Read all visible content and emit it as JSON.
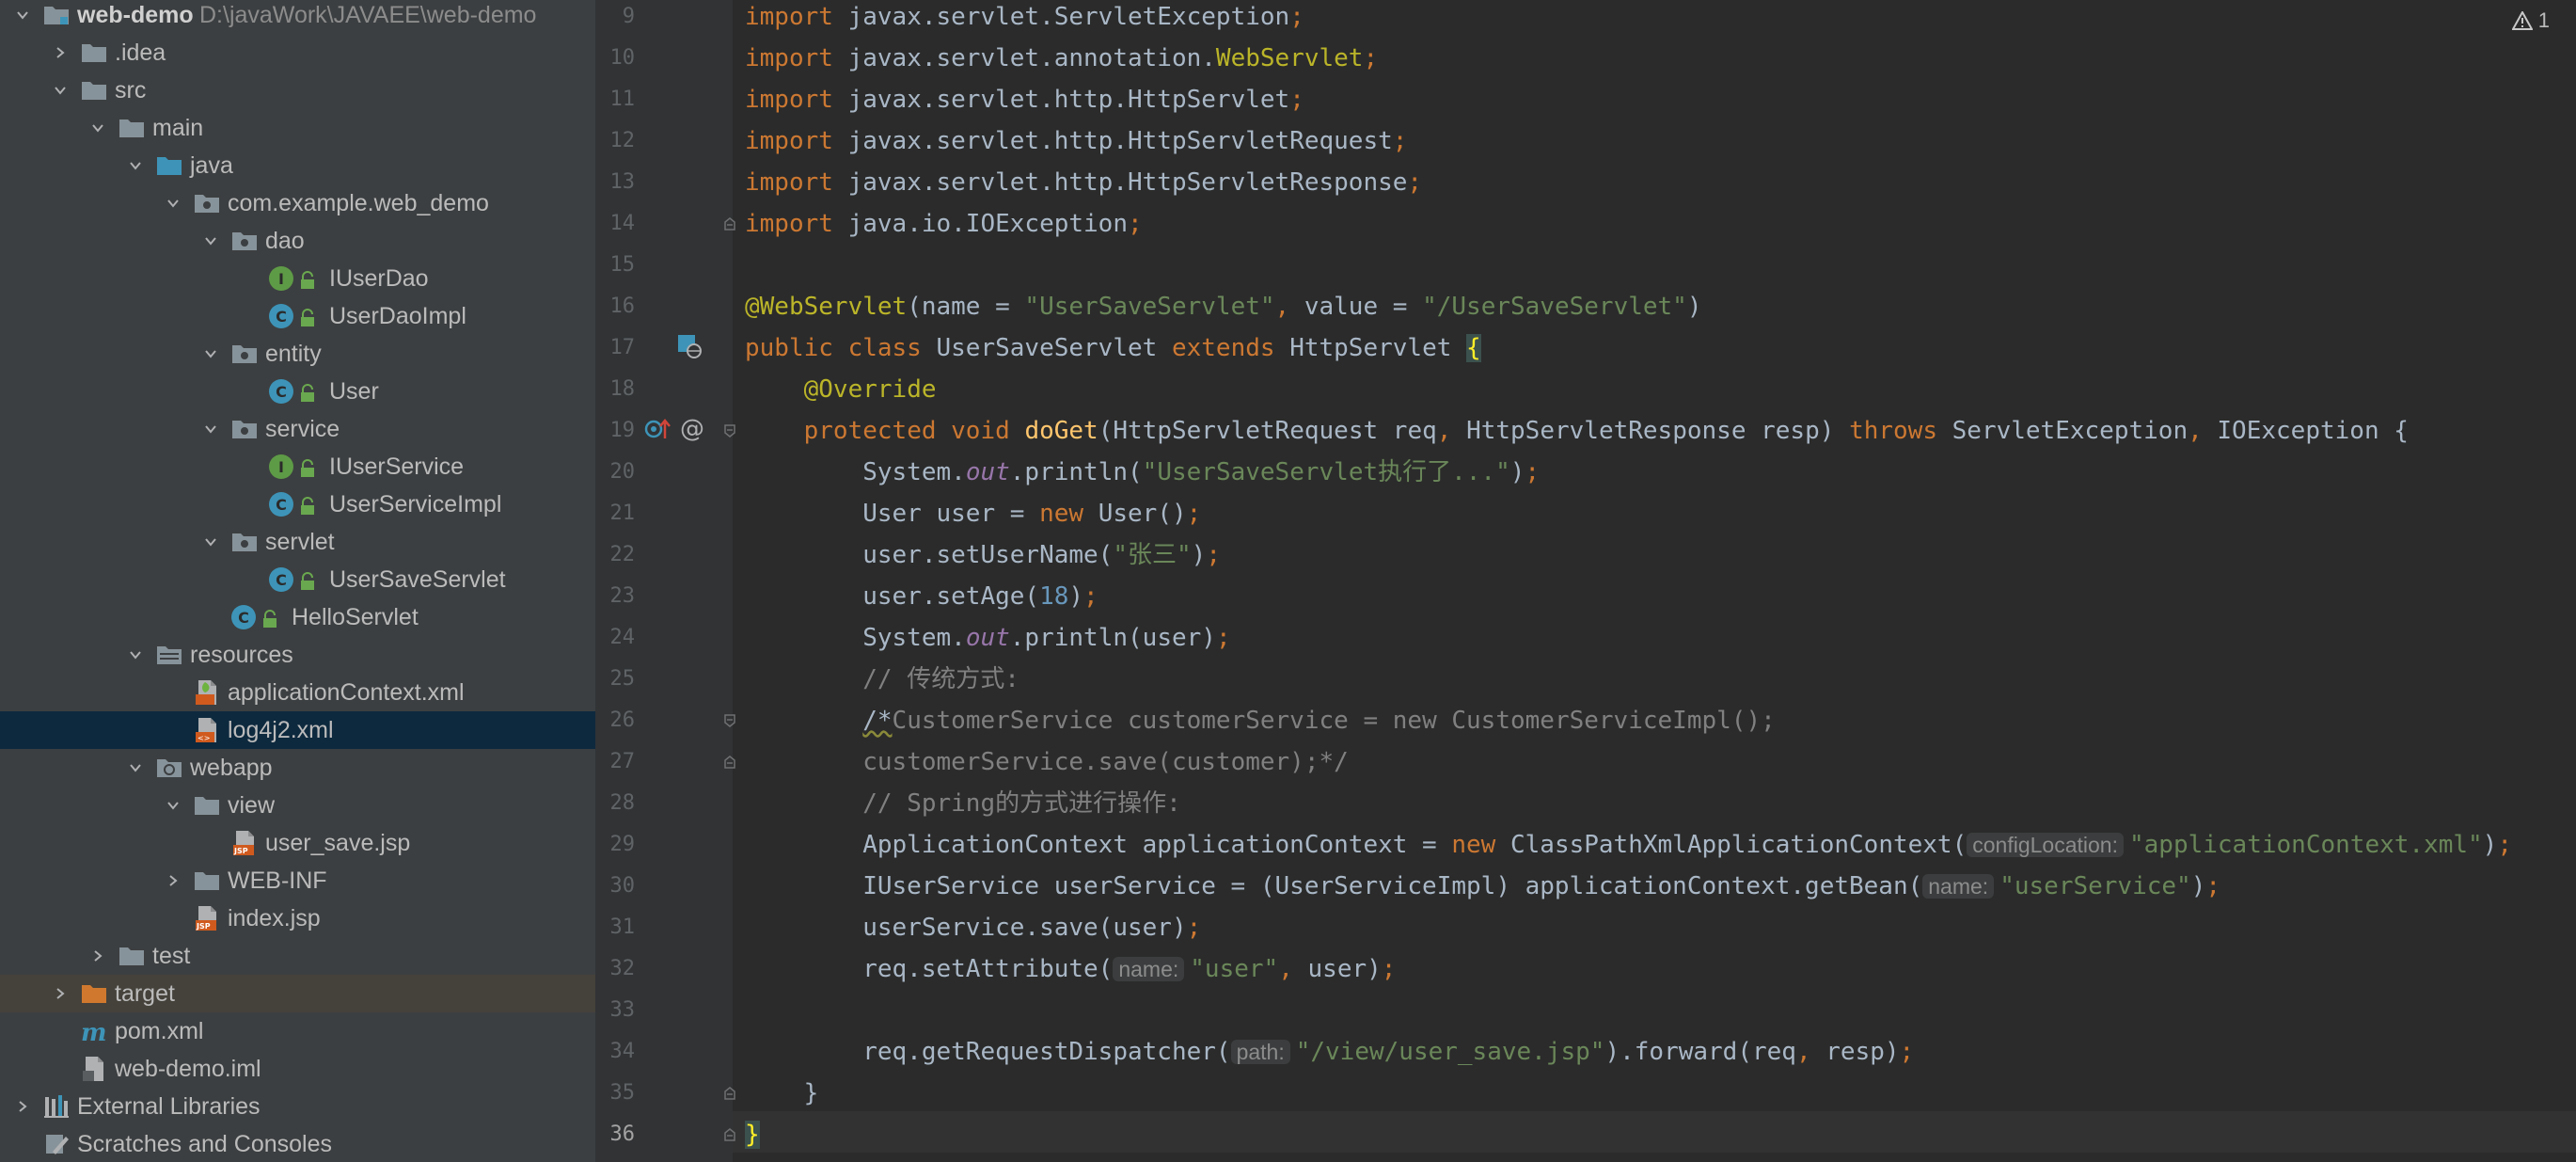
{
  "project_tree": {
    "rows": [
      {
        "label": "web-demo",
        "path": "D:\\javaWork\\JAVAEE\\web-demo",
        "indent": 0,
        "arrow": "down",
        "icon": "folder-module-icon",
        "bold": true
      },
      {
        "label": ".idea",
        "indent": 1,
        "arrow": "right",
        "icon": "folder-icon"
      },
      {
        "label": "src",
        "indent": 1,
        "arrow": "down",
        "icon": "folder-icon"
      },
      {
        "label": "main",
        "indent": 2,
        "arrow": "down",
        "icon": "folder-icon"
      },
      {
        "label": "java",
        "indent": 3,
        "arrow": "down",
        "icon": "folder-source-icon"
      },
      {
        "label": "com.example.web_demo",
        "indent": 4,
        "arrow": "down",
        "icon": "package-icon"
      },
      {
        "label": "dao",
        "indent": 5,
        "arrow": "down",
        "icon": "package-icon"
      },
      {
        "label": "IUserDao",
        "indent": 6,
        "arrow": "none",
        "icon": "interface-icon",
        "lock": true
      },
      {
        "label": "UserDaoImpl",
        "indent": 6,
        "arrow": "none",
        "icon": "class-icon",
        "lock": true
      },
      {
        "label": "entity",
        "indent": 5,
        "arrow": "down",
        "icon": "package-icon"
      },
      {
        "label": "User",
        "indent": 6,
        "arrow": "none",
        "icon": "class-icon",
        "lock": true
      },
      {
        "label": "service",
        "indent": 5,
        "arrow": "down",
        "icon": "package-icon"
      },
      {
        "label": "IUserService",
        "indent": 6,
        "arrow": "none",
        "icon": "interface-icon",
        "lock": true
      },
      {
        "label": "UserServiceImpl",
        "indent": 6,
        "arrow": "none",
        "icon": "class-icon",
        "lock": true
      },
      {
        "label": "servlet",
        "indent": 5,
        "arrow": "down",
        "icon": "package-icon"
      },
      {
        "label": "UserSaveServlet",
        "indent": 6,
        "arrow": "none",
        "icon": "class-icon",
        "lock": true
      },
      {
        "label": "HelloServlet",
        "indent": 5,
        "arrow": "none",
        "icon": "class-icon",
        "lock": true
      },
      {
        "label": "resources",
        "indent": 3,
        "arrow": "down",
        "icon": "folder-resources-icon"
      },
      {
        "label": "applicationContext.xml",
        "indent": 4,
        "arrow": "none",
        "icon": "spring-xml-icon"
      },
      {
        "label": "log4j2.xml",
        "indent": 4,
        "arrow": "none",
        "icon": "xml-file-icon",
        "selected": true
      },
      {
        "label": "webapp",
        "indent": 3,
        "arrow": "down",
        "icon": "folder-web-icon"
      },
      {
        "label": "view",
        "indent": 4,
        "arrow": "down",
        "icon": "folder-icon"
      },
      {
        "label": "user_save.jsp",
        "indent": 5,
        "arrow": "none",
        "icon": "jsp-file-icon"
      },
      {
        "label": "WEB-INF",
        "indent": 4,
        "arrow": "right",
        "icon": "folder-icon"
      },
      {
        "label": "index.jsp",
        "indent": 4,
        "arrow": "none",
        "icon": "jsp-file-icon"
      },
      {
        "label": "test",
        "indent": 2,
        "arrow": "right",
        "icon": "folder-icon"
      },
      {
        "label": "target",
        "indent": 1,
        "arrow": "right",
        "icon": "folder-excluded-icon",
        "excluded": true
      },
      {
        "label": "pom.xml",
        "indent": 1,
        "arrow": "none",
        "icon": "maven-icon"
      },
      {
        "label": "web-demo.iml",
        "indent": 1,
        "arrow": "none",
        "icon": "iml-file-icon"
      },
      {
        "label": "External Libraries",
        "indent": 0,
        "arrow": "right",
        "icon": "libraries-icon"
      },
      {
        "label": "Scratches and Consoles",
        "indent": 0,
        "arrow": "none",
        "icon": "scratches-icon"
      }
    ]
  },
  "editor": {
    "warning_count": "1",
    "current_line": 36,
    "lines": [
      {
        "num": "9",
        "tokens": [
          [
            "kw",
            "import "
          ],
          [
            "",
            "javax.servlet.ServletException"
          ],
          [
            "kw",
            ";"
          ]
        ]
      },
      {
        "num": "10",
        "tokens": [
          [
            "kw",
            "import "
          ],
          [
            "",
            "javax.servlet.annotation."
          ],
          [
            "ann",
            "WebServlet"
          ],
          [
            "kw",
            ";"
          ]
        ]
      },
      {
        "num": "11",
        "tokens": [
          [
            "kw",
            "import "
          ],
          [
            "",
            "javax.servlet.http.HttpServlet"
          ],
          [
            "kw",
            ";"
          ]
        ]
      },
      {
        "num": "12",
        "tokens": [
          [
            "kw",
            "import "
          ],
          [
            "",
            "javax.servlet.http.HttpServletRequest"
          ],
          [
            "kw",
            ";"
          ]
        ]
      },
      {
        "num": "13",
        "tokens": [
          [
            "kw",
            "import "
          ],
          [
            "",
            "javax.servlet.http.HttpServletResponse"
          ],
          [
            "kw",
            ";"
          ]
        ]
      },
      {
        "num": "14",
        "tokens": [
          [
            "kw",
            "import "
          ],
          [
            "",
            "java.io.IOException"
          ],
          [
            "kw",
            ";"
          ]
        ]
      },
      {
        "num": "15",
        "tokens": []
      },
      {
        "num": "16",
        "tokens": [
          [
            "ann",
            "@WebServlet"
          ],
          [
            "",
            "(name = "
          ],
          [
            "str",
            "\"UserSaveServlet\""
          ],
          [
            "kw",
            ", "
          ],
          [
            "",
            "value = "
          ],
          [
            "str",
            "\"/UserSaveServlet\""
          ],
          [
            "",
            ")"
          ]
        ]
      },
      {
        "num": "17",
        "tokens": [
          [
            "kw",
            "public class "
          ],
          [
            "",
            "UserSaveServlet "
          ],
          [
            "kw",
            "extends "
          ],
          [
            "",
            "HttpServlet "
          ],
          [
            "brace",
            "{"
          ]
        ]
      },
      {
        "num": "18",
        "tokens": [
          [
            "",
            "    "
          ],
          [
            "ann",
            "@Override"
          ]
        ]
      },
      {
        "num": "19",
        "tokens": [
          [
            "",
            "    "
          ],
          [
            "kw",
            "protected void "
          ],
          [
            "fn",
            "doGet"
          ],
          [
            "",
            "(HttpServletRequest req"
          ],
          [
            "kw",
            ", "
          ],
          [
            "",
            "HttpServletResponse resp) "
          ],
          [
            "kw",
            "throws "
          ],
          [
            "",
            "ServletException"
          ],
          [
            "kw",
            ", "
          ],
          [
            "",
            "IOException {"
          ]
        ]
      },
      {
        "num": "20",
        "tokens": [
          [
            "",
            "        System."
          ],
          [
            "st",
            "out"
          ],
          [
            "",
            ".println("
          ],
          [
            "str",
            "\"UserSaveServlet执行了...\""
          ],
          [
            "",
            ")"
          ],
          [
            "kw",
            ";"
          ]
        ]
      },
      {
        "num": "21",
        "tokens": [
          [
            "",
            "        User user = "
          ],
          [
            "kw",
            "new "
          ],
          [
            "",
            "User()"
          ],
          [
            "kw",
            ";"
          ]
        ]
      },
      {
        "num": "22",
        "tokens": [
          [
            "",
            "        user.setUserName("
          ],
          [
            "str",
            "\"张三\""
          ],
          [
            "",
            ")"
          ],
          [
            "kw",
            ";"
          ]
        ]
      },
      {
        "num": "23",
        "tokens": [
          [
            "",
            "        user.setAge("
          ],
          [
            "num",
            "18"
          ],
          [
            "",
            ")"
          ],
          [
            "kw",
            ";"
          ]
        ]
      },
      {
        "num": "24",
        "tokens": [
          [
            "",
            "        System."
          ],
          [
            "st",
            "out"
          ],
          [
            "",
            ".println(user)"
          ],
          [
            "kw",
            ";"
          ]
        ]
      },
      {
        "num": "25",
        "tokens": [
          [
            "",
            "        "
          ],
          [
            "cmt",
            "// 传统方式:"
          ]
        ]
      },
      {
        "num": "26",
        "tokens": [
          [
            "",
            "        "
          ],
          [
            "squig",
            "/*"
          ],
          [
            "cmt",
            "CustomerService customerService = new CustomerServiceImpl();"
          ]
        ]
      },
      {
        "num": "27",
        "tokens": [
          [
            "",
            "        "
          ],
          [
            "cmt",
            "customerService.save(customer);*/"
          ]
        ]
      },
      {
        "num": "28",
        "tokens": [
          [
            "",
            "        "
          ],
          [
            "cmt",
            "// Spring的方式进行操作:"
          ]
        ]
      },
      {
        "num": "29",
        "tokens": [
          [
            "",
            "        ApplicationContext applicationContext = "
          ],
          [
            "kw",
            "new "
          ],
          [
            "",
            "ClassPathXmlApplicationContext("
          ],
          [
            "hint",
            "configLocation:"
          ],
          [
            "str",
            "\"applicationContext.xml\""
          ],
          [
            "",
            ")"
          ],
          [
            "kw",
            ";"
          ]
        ]
      },
      {
        "num": "30",
        "tokens": [
          [
            "",
            "        IUserService userService = (UserServiceImpl) applicationContext.getBean("
          ],
          [
            "hint",
            "name:"
          ],
          [
            "str",
            "\"userService\""
          ],
          [
            "",
            ")"
          ],
          [
            "kw",
            ";"
          ]
        ]
      },
      {
        "num": "31",
        "tokens": [
          [
            "",
            "        userService.save(user)"
          ],
          [
            "kw",
            ";"
          ]
        ]
      },
      {
        "num": "32",
        "tokens": [
          [
            "",
            "        req.setAttribute("
          ],
          [
            "hint",
            "name:"
          ],
          [
            "str",
            "\"user\""
          ],
          [
            "kw",
            ", "
          ],
          [
            "",
            "user)"
          ],
          [
            "kw",
            ";"
          ]
        ]
      },
      {
        "num": "33",
        "tokens": []
      },
      {
        "num": "34",
        "tokens": [
          [
            "",
            "        req.getRequestDispatcher("
          ],
          [
            "hint",
            "path:"
          ],
          [
            "str",
            "\"/view/user_save.jsp\""
          ],
          [
            "",
            ").forward(req"
          ],
          [
            "kw",
            ", "
          ],
          [
            "",
            "resp)"
          ],
          [
            "kw",
            ";"
          ]
        ]
      },
      {
        "num": "35",
        "tokens": [
          [
            "",
            "    }"
          ]
        ]
      },
      {
        "num": "36",
        "tokens": [
          [
            "brace",
            "}"
          ]
        ]
      }
    ]
  }
}
